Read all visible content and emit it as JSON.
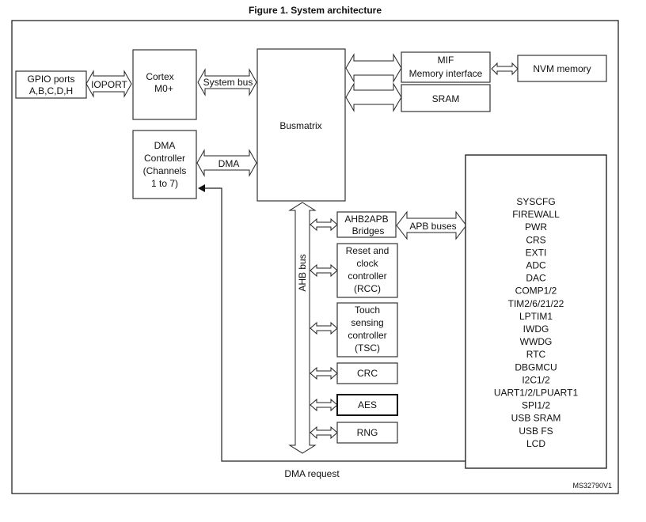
{
  "figure": {
    "title": "Figure 1. System architecture",
    "reference_id": "MS32790V1"
  },
  "blocks": {
    "gpio": [
      "GPIO ports",
      "A,B,C,D,H"
    ],
    "cortex": [
      "Cortex",
      "M0+"
    ],
    "dma_controller": [
      "DMA",
      "Controller",
      "(Channels",
      "1 to 7)"
    ],
    "busmatrix": "Busmatrix",
    "mif": [
      "MIF",
      "Memory interface"
    ],
    "nvm": "NVM memory",
    "sram": "SRAM",
    "ahb2apb": [
      "AHB2APB",
      "Bridges"
    ],
    "rcc": [
      "Reset and",
      "clock",
      "controller",
      "(RCC)"
    ],
    "tsc": [
      "Touch",
      "sensing",
      "controller",
      "(TSC)"
    ],
    "crc": "CRC",
    "aes": "AES",
    "rng": "RNG"
  },
  "buses": {
    "ioport": "IOPORT",
    "system_bus": "System bus",
    "dma": "DMA",
    "ahb_bus": "AHB bus",
    "apb_buses": "APB buses",
    "dma_request": "DMA request"
  },
  "peripherals": [
    "SYSCFG",
    "FIREWALL",
    "PWR",
    "CRS",
    "EXTI",
    "ADC",
    "DAC",
    "COMP1/2",
    "TIM2/6/21/22",
    "LPTIM1",
    "IWDG",
    "WWDG",
    "RTC",
    "DBGMCU",
    "I2C1/2",
    "UART1/2/LPUART1",
    "SPI1/2",
    "USB SRAM",
    "USB FS",
    "LCD"
  ]
}
